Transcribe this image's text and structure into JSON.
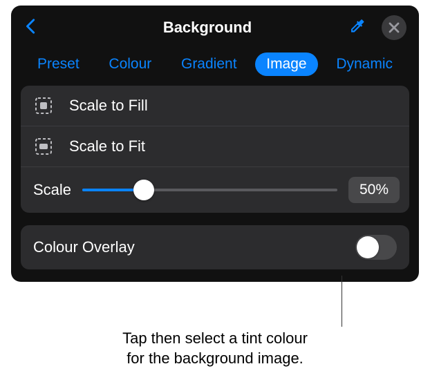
{
  "header": {
    "title": "Background"
  },
  "tabs": [
    {
      "label": "Preset",
      "active": false
    },
    {
      "label": "Colour",
      "active": false
    },
    {
      "label": "Gradient",
      "active": false
    },
    {
      "label": "Image",
      "active": true
    },
    {
      "label": "Dynamic",
      "active": false
    }
  ],
  "modes": [
    {
      "label": "Scale to Fill"
    },
    {
      "label": "Scale to Fit"
    }
  ],
  "scale": {
    "label": "Scale",
    "value_display": "50%",
    "percent": 50
  },
  "overlay": {
    "label": "Colour Overlay",
    "enabled": false
  },
  "callout": {
    "line1": "Tap then select a tint colour",
    "line2": "for the background image."
  },
  "colors": {
    "accent": "#0a84ff",
    "panel_bg": "#111111",
    "row_bg": "#2c2c2e"
  }
}
